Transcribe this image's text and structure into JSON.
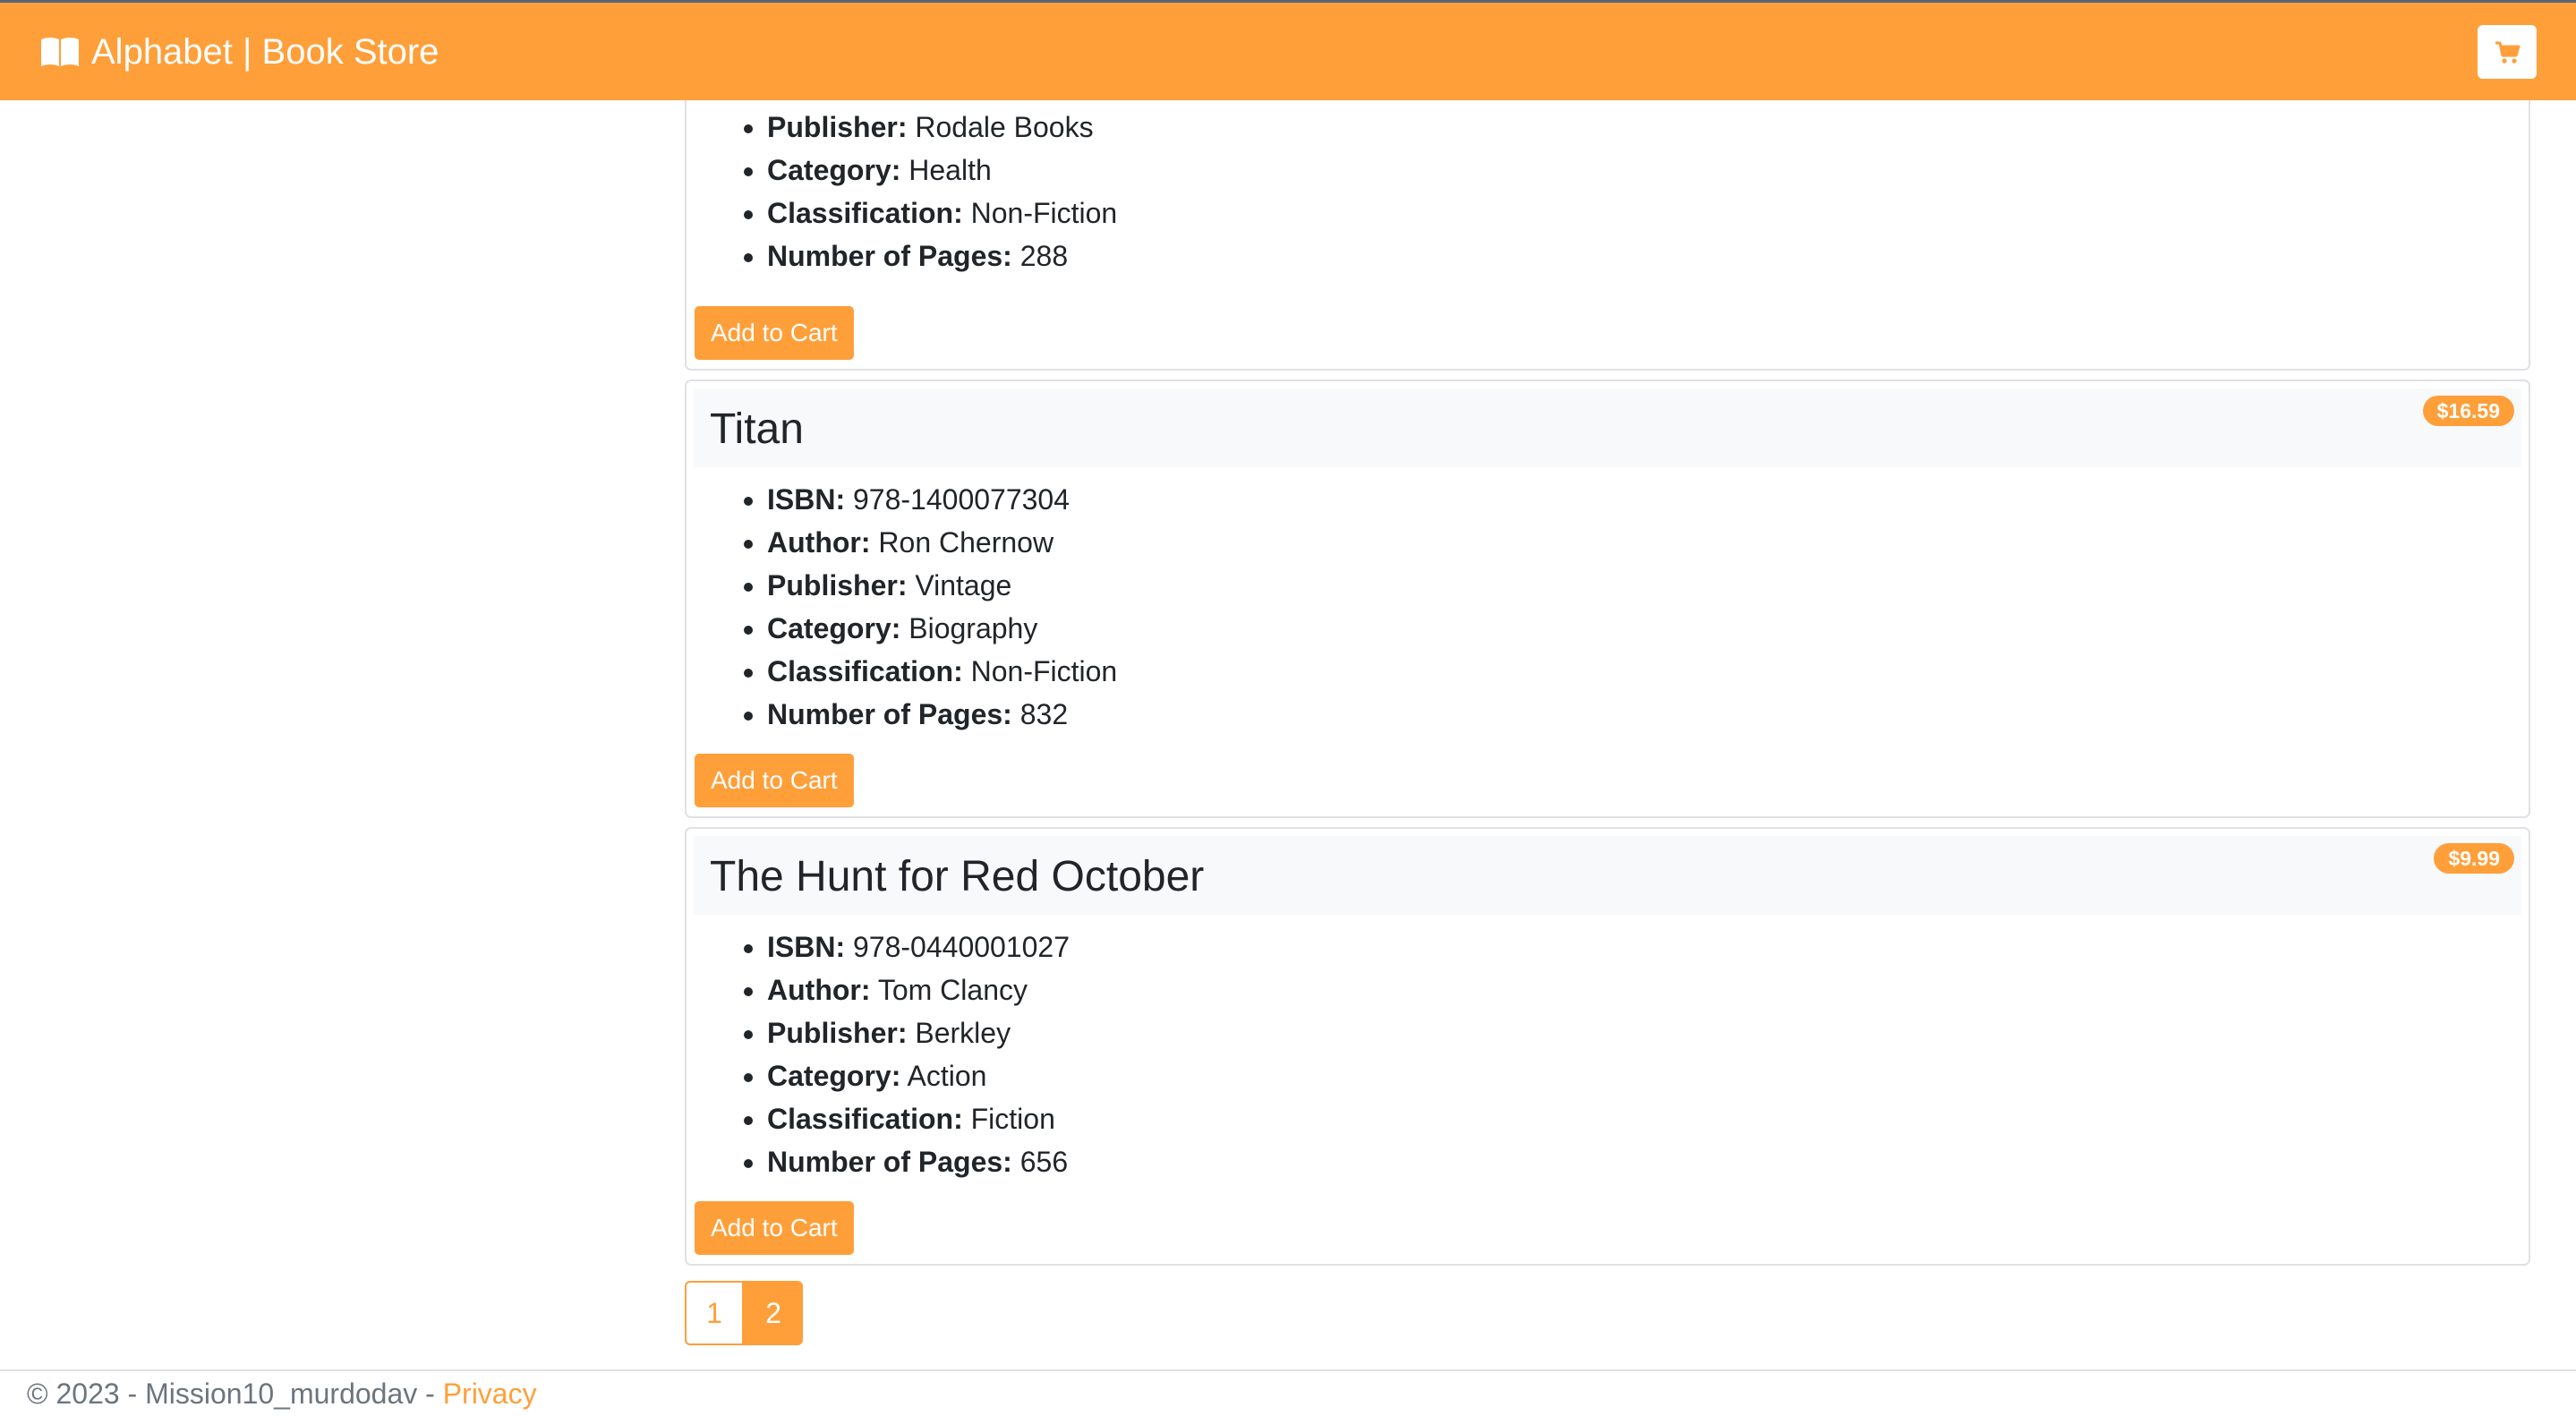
{
  "navbar": {
    "brand": "Alphabet | Book Store",
    "brand_icon": "book-open-icon",
    "cart_icon": "shopping-cart-icon"
  },
  "books": [
    {
      "title": "",
      "price": "",
      "details": [
        {
          "label": "Publisher:",
          "value": "Rodale Books"
        },
        {
          "label": "Category:",
          "value": "Health"
        },
        {
          "label": "Classification:",
          "value": "Non-Fiction"
        },
        {
          "label": "Number of Pages:",
          "value": "288"
        }
      ],
      "button": "Add to Cart"
    },
    {
      "title": "Titan",
      "price": "$16.59",
      "details": [
        {
          "label": "ISBN:",
          "value": "978-1400077304"
        },
        {
          "label": "Author:",
          "value": "Ron Chernow"
        },
        {
          "label": "Publisher:",
          "value": "Vintage"
        },
        {
          "label": "Category:",
          "value": "Biography"
        },
        {
          "label": "Classification:",
          "value": "Non-Fiction"
        },
        {
          "label": "Number of Pages:",
          "value": "832"
        }
      ],
      "button": "Add to Cart"
    },
    {
      "title": "The Hunt for Red October",
      "price": "$9.99",
      "details": [
        {
          "label": "ISBN:",
          "value": "978-0440001027"
        },
        {
          "label": "Author:",
          "value": "Tom Clancy"
        },
        {
          "label": "Publisher:",
          "value": "Berkley"
        },
        {
          "label": "Category:",
          "value": "Action"
        },
        {
          "label": "Classification:",
          "value": "Fiction"
        },
        {
          "label": "Number of Pages:",
          "value": "656"
        }
      ],
      "button": "Add to Cart"
    }
  ],
  "pagination": {
    "pages": [
      "1",
      "2"
    ],
    "active": "2"
  },
  "footer": {
    "text": "© 2023 - Mission10_murdodav - ",
    "link": "Privacy"
  },
  "colors": {
    "accent": "#ff9f3a",
    "header_bg": "#f8f9fa",
    "border": "#dfe1e4"
  }
}
